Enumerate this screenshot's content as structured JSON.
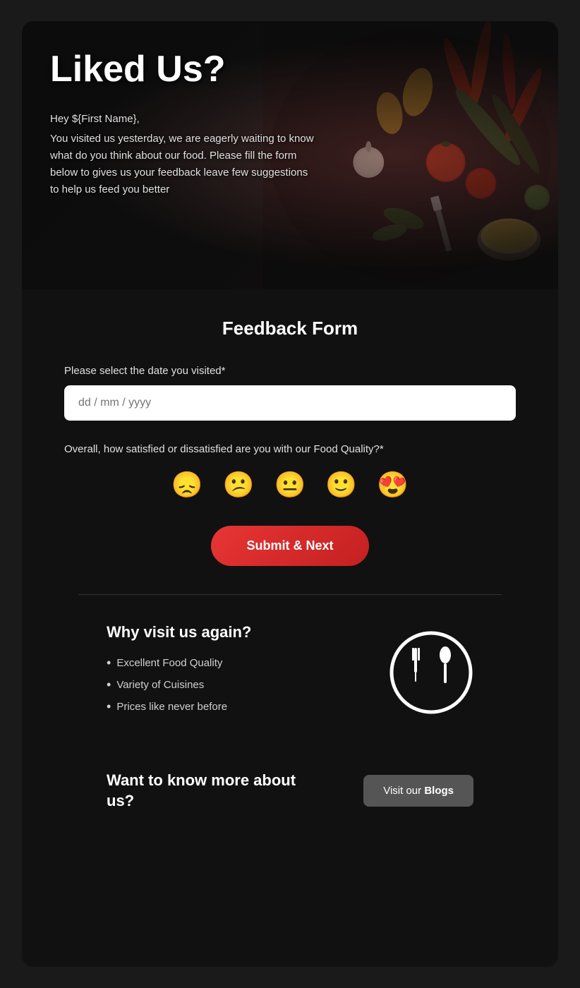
{
  "hero": {
    "title": "Liked Us?",
    "greeting": "Hey ${First Name},",
    "body": "You visited us yesterday, we are eagerly waiting to know what do you think about our food. Please fill the form below to gives us your feedback leave few suggestions to help us feed you better"
  },
  "form": {
    "section_title": "Feedback Form",
    "date_label": "Please select the date you visited*",
    "date_placeholder": "dd / mm / yyyy",
    "satisfaction_label": "Overall, how satisfied or dissatisfied are you with our Food Quality?*",
    "emojis": [
      {
        "symbol": "😞",
        "name": "very-dissatisfied",
        "label": "Very Dissatisfied"
      },
      {
        "symbol": "😕",
        "name": "dissatisfied",
        "label": "Dissatisfied"
      },
      {
        "symbol": "😐",
        "name": "neutral",
        "label": "Neutral"
      },
      {
        "symbol": "🙂",
        "name": "satisfied",
        "label": "Satisfied"
      },
      {
        "symbol": "😍",
        "name": "very-satisfied",
        "label": "Very Satisfied"
      }
    ],
    "submit_label": "Submit & Next"
  },
  "why_section": {
    "title": "Why visit us again?",
    "items": [
      "Excellent Food Quality",
      "Variety of Cuisines",
      "Prices like never before"
    ]
  },
  "blog_section": {
    "title": "Want to know more about us?",
    "button_prefix": "Visit our ",
    "button_highlight": "Blogs",
    "button_full": "Visit our Blogs"
  }
}
